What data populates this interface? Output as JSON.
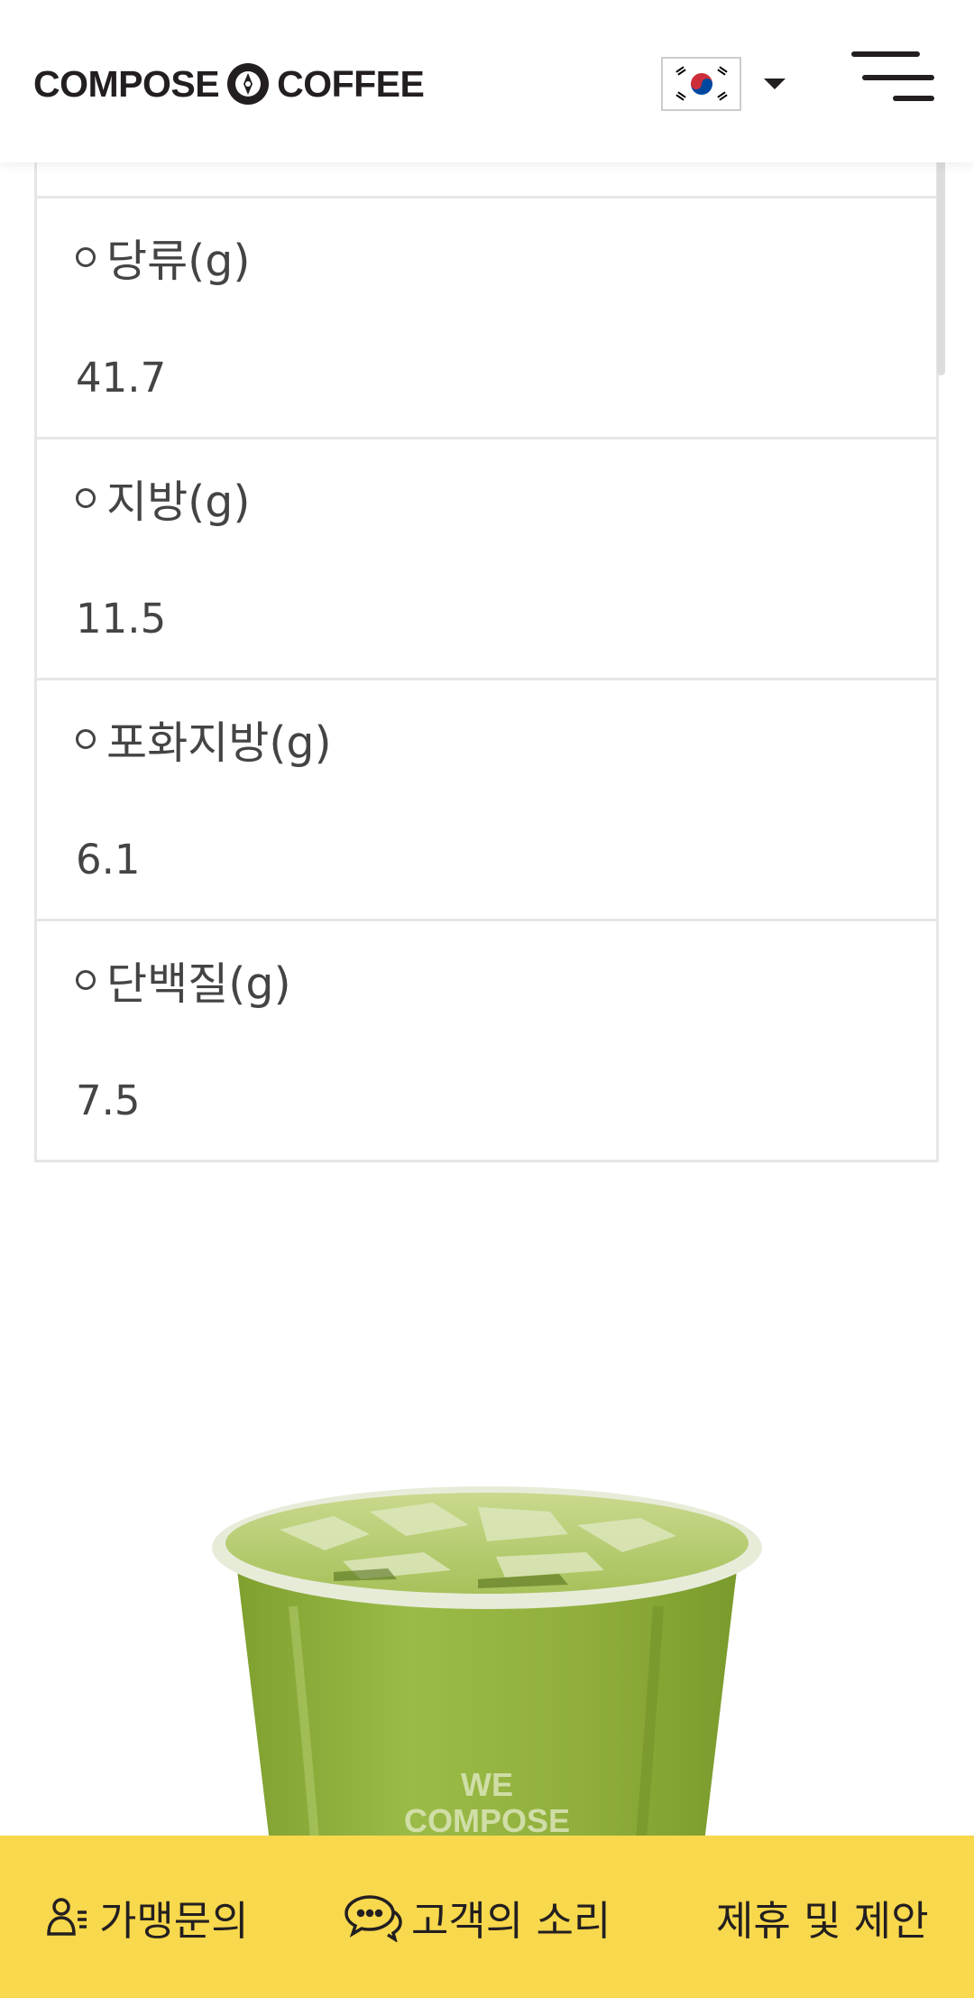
{
  "header": {
    "logo": {
      "left": "COMPOSE",
      "right": "COFFEE",
      "emblem_top": "COMPOSE",
      "emblem_bottom": "COFFEE"
    },
    "language": {
      "selected": "ko",
      "flag_icon": "korea-flag-icon"
    },
    "menu_icon": "hamburger-menu-icon"
  },
  "nutrition": {
    "rows": [
      {
        "label": "당류(g)",
        "value": "41.7"
      },
      {
        "label": "지방(g)",
        "value": "11.5"
      },
      {
        "label": "포화지방(g)",
        "value": "6.1"
      },
      {
        "label": "단백질(g)",
        "value": "7.5"
      }
    ]
  },
  "product_image": {
    "cup_text": "WE COMPOSE"
  },
  "bottom_bar": {
    "items": [
      {
        "label": "가맹문의",
        "icon": "person-list-icon"
      },
      {
        "label": "고객의 소리",
        "icon": "chat-bubble-icon"
      },
      {
        "label": "제휴 및 제안",
        "icon": ""
      }
    ]
  },
  "colors": {
    "accent": "#f8d84c",
    "text": "#231f20",
    "border": "#e6e6e6",
    "matcha": "#8fae3b"
  }
}
